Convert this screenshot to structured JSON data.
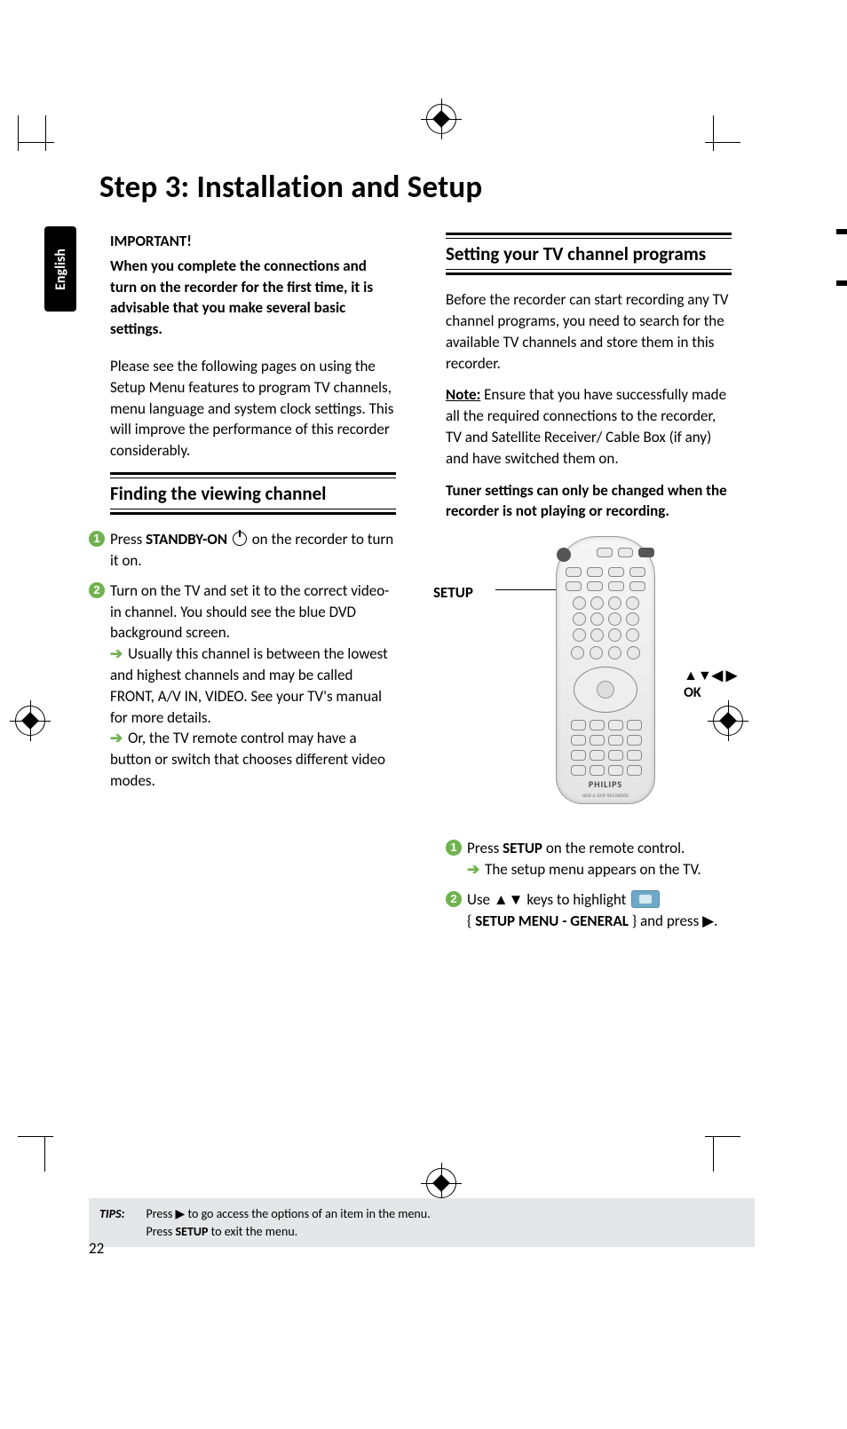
{
  "lang_tab": "English",
  "title": "Step 3: Installation and Setup",
  "left": {
    "important_heading": "IMPORTANT!",
    "important_body": "When you complete the connections and turn on the recorder for the first time, it is advisable that you make several basic settings.",
    "intro": "Please see the following pages on using the Setup Menu features to program TV channels, menu language and system clock settings. This will improve the performance of this recorder considerably.",
    "section1": "Finding the viewing channel",
    "step1_a": "Press ",
    "step1_b": "STANDBY-ON",
    "step1_c": " on the recorder to turn it on.",
    "step2_a": "Turn on the TV and set it to the correct video-in channel.  You should see the blue DVD background screen.",
    "step2_b": " Usually this channel is between the lowest and highest channels and may be called FRONT, A/V IN, VIDEO. See your TV's manual for more details.",
    "step2_c": " Or, the TV remote control may have a button or switch that chooses different video modes."
  },
  "right": {
    "section2": "Setting your TV channel programs",
    "p1": "Before the recorder can start recording any TV channel programs, you need to search for the available TV channels and store them in this recorder.",
    "note_label": "Note:",
    "note_body": " Ensure that you have successfully made all the required connections to the recorder, TV and Satellite Receiver/ Cable Box (if any) and have switched them on.",
    "warn": "Tuner settings can only be changed when the recorder is not playing or recording.",
    "setup_label": "SETUP",
    "nav_arrows": "▲▼◀ ▶",
    "nav_ok": "OK",
    "remote_brand": "PHILIPS",
    "remote_sub": "HDD & DVD RECORDER",
    "step1_a": "Press ",
    "step1_b": "SETUP",
    "step1_c": " on the remote control.",
    "step1_d": " The setup menu appears on the TV.",
    "step2_a": "Use ",
    "step2_arrows": "▲▼",
    "step2_b": " keys to highlight ",
    "step2_menu": "SETUP MENU - GENERAL",
    "step2_c": " } and press ",
    "step2_play": "▶"
  },
  "tips": {
    "label": "TIPS:",
    "line1_a": "Press ",
    "line1_icon": "▶",
    "line1_b": " to go access the options of an item in the menu.",
    "line2_a": "Press ",
    "line2_b": "SETUP",
    "line2_c": " to exit the menu."
  },
  "page_number": "22"
}
